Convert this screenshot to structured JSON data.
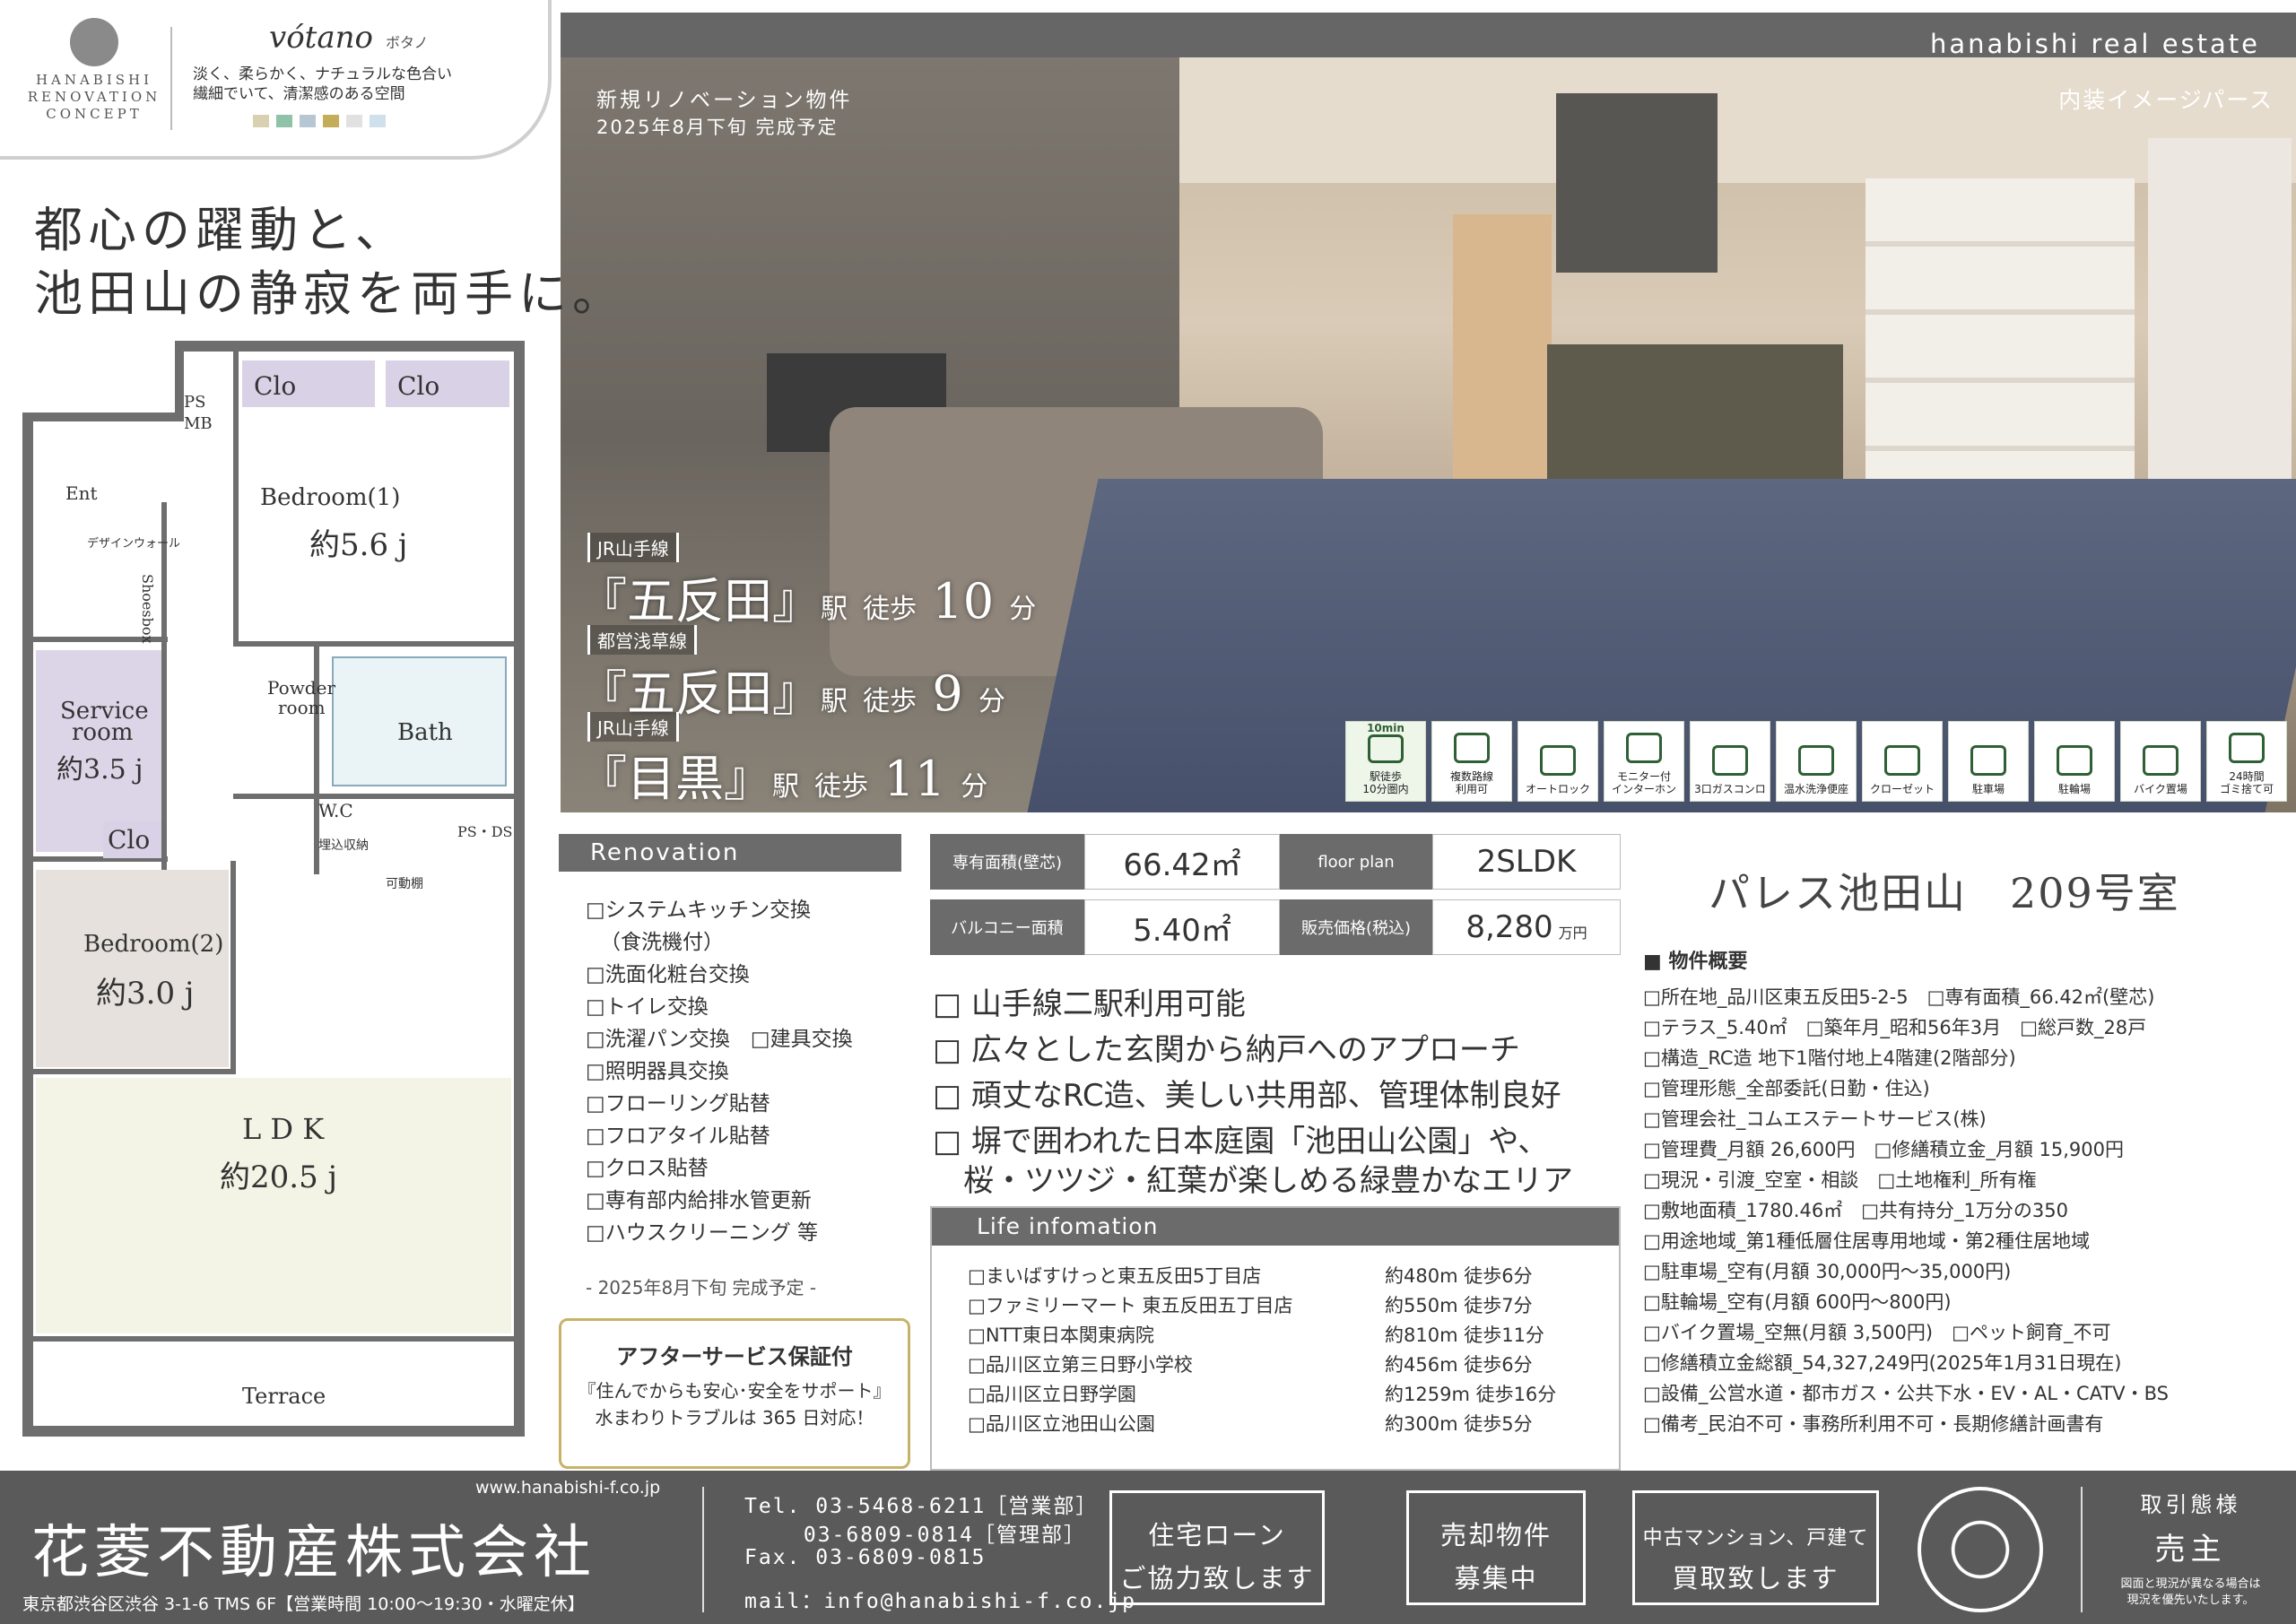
{
  "concept": {
    "logo_lines": [
      "HANABISHI",
      "RENOVATION",
      "CONCEPT"
    ],
    "brand": "vótano",
    "brand_kana": "ボタノ",
    "desc1": "淡く、柔らかく、ナチュラルな色合い",
    "desc2": "繊細でいて、清潔感のある空間",
    "swatches": [
      "#d8d0b0",
      "#8fc2a8",
      "#b6c7d3",
      "#c3ad58",
      "#e1e1e1",
      "#cfe0ea"
    ]
  },
  "header": {
    "brand": "hanabishi real estate"
  },
  "photo": {
    "caption_line1": "新規リノベーション物件",
    "caption_line2": "2025年8月下旬 完成予定",
    "caption_right": "内装イメージパース"
  },
  "stations": [
    {
      "line": "JR山手線",
      "name": "『五反田』",
      "suffix": "駅",
      "walk": "徒歩",
      "minutes": "10",
      "unit": "分"
    },
    {
      "line": "都営浅草線",
      "name": "『五反田』",
      "suffix": "駅",
      "walk": "徒歩",
      "minutes": "9",
      "unit": "分"
    },
    {
      "line": "JR山手線",
      "name": "『目黒』",
      "suffix": "駅",
      "walk": "徒歩",
      "minutes": "11",
      "unit": "分"
    }
  ],
  "amenities": [
    {
      "label1": "駅徒歩",
      "label2": "10分圏内",
      "top": "10min",
      "icon": "walking-icon",
      "highlight": true
    },
    {
      "label1": "複数路線",
      "label2": "利用可",
      "icon": "train-icon",
      "highlight": false
    },
    {
      "label1": "オートロック",
      "label2": "",
      "icon": "lock-panel-icon",
      "highlight": false
    },
    {
      "label1": "モニター付",
      "label2": "インターホン",
      "icon": "intercom-icon",
      "highlight": false
    },
    {
      "label1": "3口ガスコンロ",
      "label2": "",
      "icon": "stove-icon",
      "highlight": false
    },
    {
      "label1": "温水洗浄便座",
      "label2": "",
      "icon": "toilet-icon",
      "highlight": false
    },
    {
      "label1": "クローゼット",
      "label2": "",
      "icon": "closet-icon",
      "highlight": false
    },
    {
      "label1": "駐車場",
      "label2": "",
      "icon": "car-icon",
      "highlight": false
    },
    {
      "label1": "駐輪場",
      "label2": "",
      "icon": "bicycle-icon",
      "highlight": false
    },
    {
      "label1": "バイク置場",
      "label2": "",
      "icon": "motorbike-icon",
      "highlight": false
    },
    {
      "label1": "24時間",
      "label2": "ゴミ捨て可",
      "icon": "trash-icon",
      "highlight": false
    }
  ],
  "headline": {
    "line1": "都心の躍動と、",
    "line2": "池田山の静寂を両手に。"
  },
  "plan": {
    "clo1": "Clo",
    "clo2": "Clo",
    "clo3": "Clo",
    "psmb": "PS",
    "psmb2": "MB",
    "ent": "Ent",
    "design_wall": "デザインウォール",
    "shoesbox": "Shoesbox",
    "bedroom1": "Bedroom(1)",
    "bedroom1_size": "約5.6 j",
    "service": "Service",
    "service2": "room",
    "service_size": "約3.5 j",
    "powder": "Powder",
    "powder2": "room",
    "bath": "Bath",
    "wc": "W.C",
    "wc_storage": "埋込収納",
    "psds": "PS・DS",
    "shelf": "可動棚",
    "bedroom2": "Bedroom(2)",
    "bedroom2_size": "約3.0 j",
    "ldk": "L D K",
    "ldk_size": "約20.5 j",
    "terrace": "Terrace"
  },
  "renovation": {
    "title": "Renovation",
    "items": [
      "□システムキッチン交換",
      "（食洗機付）",
      "□洗面化粧台交換",
      "□トイレ交換",
      "□洗濯パン交換　□建具交換",
      "□照明器具交換",
      "□フローリング貼替",
      "□フロアタイル貼替",
      "□クロス貼替",
      "□専有部内給排水管更新",
      "□ハウスクリーニング 等"
    ],
    "note": "- 2025年8月下旬 完成予定 -"
  },
  "after_service": {
    "title": "アフターサービス保証付",
    "line1": "『住んでからも安心･安全をサポート』",
    "line2": "水まわりトラブルは 365 日対応！"
  },
  "spec": {
    "area_label": "専有面積(壁芯)",
    "area_value": "66.42㎡",
    "plan_label": "floor plan",
    "plan_value": "2SLDK",
    "balcony_label": "バルコニー面積",
    "balcony_value": "5.40㎡",
    "price_label": "販売価格(税込)",
    "price_value": "8,280",
    "price_unit": "万円"
  },
  "features": [
    "□ 山手線二駅利用可能",
    "□ 広々とした玄関から納戸へのアプローチ",
    "□ 頑丈なRC造、美しい共用部、管理体制良好",
    "□ 塀で囲われた日本庭園「池田山公園」や、",
    "　桜・ツツジ・紅葉が楽しめる緑豊かなエリア"
  ],
  "life": {
    "title": "Life infomation",
    "rows": [
      {
        "name": "□まいばすけっと東五反田5丁目店",
        "dist": "約480m 徒歩6分"
      },
      {
        "name": "□ファミリーマート 東五反田五丁目店",
        "dist": "約550m 徒歩7分"
      },
      {
        "name": "□NTT東日本関東病院",
        "dist": "約810m 徒歩11分"
      },
      {
        "name": "□品川区立第三日野小学校",
        "dist": "約456m 徒歩6分"
      },
      {
        "name": "□品川区立日野学園",
        "dist": "約1259m 徒歩16分"
      },
      {
        "name": "□品川区立池田山公園",
        "dist": "約300m 徒歩5分"
      }
    ]
  },
  "property": {
    "title": "パレス池田山　209号室",
    "subhead": "■ 物件概要",
    "lines": [
      "□所在地_品川区東五反田5-2-5　□専有面積_66.42㎡(壁芯)",
      "□テラス_5.40㎡　□築年月_昭和56年3月　□総戸数_28戸",
      "□構造_RC造 地下1階付地上4階建(2階部分)",
      "□管理形態_全部委託(日勤・住込)",
      "□管理会社_コムエステートサービス(株)",
      "□管理費_月額 26,600円　□修繕積立金_月額 15,900円",
      "□現況・引渡_空室・相談　□土地権利_所有権",
      "□敷地面積_1780.46㎡　□共有持分_1万分の350",
      "□用途地域_第1種低層住居専用地域・第2種住居地域",
      "□駐車場_空有(月額 30,000円〜35,000円)",
      "□駐輪場_空有(月額 600円〜800円)",
      "□バイク置場_空無(月額 3,500円)　□ペット飼育_不可",
      "□修繕積立金総額_54,327,249円(2025年1月31日現在)",
      "□設備_公営水道・都市ガス・公共下水・EV・AL・CATV・BS",
      "□備考_民泊不可・事務所利用不可・長期修繕計画書有"
    ]
  },
  "footer": {
    "url": "www.hanabishi-f.co.jp",
    "company": "花菱不動産株式会社",
    "address": "東京都渋谷区渋谷 3-1-6 TMS 6F【営業時間 10:00〜19:30・水曜定休】",
    "tel1": "Tel. 03-5468-6211［営業部］",
    "tel2": "　　 03-6809-0814［管理部］",
    "fax": "Fax. 03-6809-0815",
    "mail": "mail：info@hanabishi-f.co.jp",
    "box1_l1": "住宅ローン",
    "box1_l2": "ご協力致します",
    "box2_l1": "売却物件",
    "box2_l2": "募集中",
    "box3_l1": "中古マンション、戸建て",
    "box3_l2": "買取致します",
    "deal_label": "取引態様",
    "deal_value": "売主",
    "deal_note1": "図面と現況が異なる場合は",
    "deal_note2": "現況を優先いたします。"
  }
}
